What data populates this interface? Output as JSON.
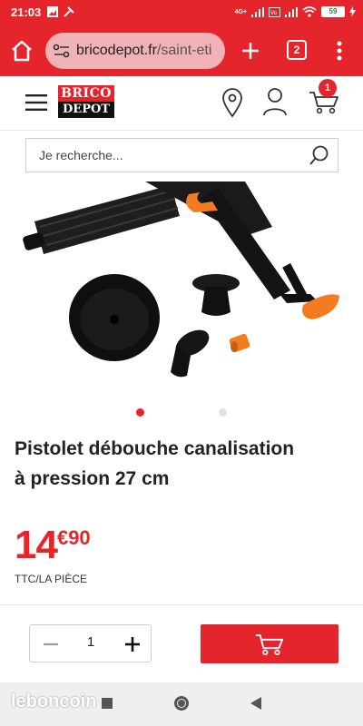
{
  "status_bar": {
    "time": "21:03",
    "network": "4G+",
    "battery": "59"
  },
  "browser": {
    "url_domain": "bricodepot.fr",
    "url_path": "/saint-eti",
    "tab_count": "2"
  },
  "site": {
    "logo_top": "BRICO",
    "logo_bottom": "DEPOT",
    "cart_count": "1"
  },
  "search": {
    "placeholder": "Je recherche..."
  },
  "gallery": {
    "total_slides": 2,
    "active_index": 0
  },
  "product": {
    "title_line1": "Pistolet débouche canalisation",
    "title_line2": "à pression 27 cm",
    "price_main": "14",
    "price_cents": "€90",
    "unit": "TTC/LA PIÈCE",
    "quantity": "1"
  },
  "colors": {
    "brand_red": "#e5252c",
    "accent_orange": "#f47b20"
  },
  "watermark": "leboncoin"
}
